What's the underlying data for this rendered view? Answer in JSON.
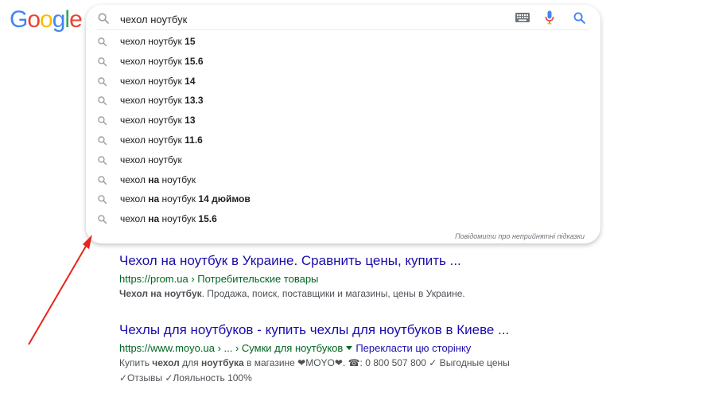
{
  "logo": {
    "letters": [
      "G",
      "o",
      "o",
      "g",
      "l",
      "e"
    ],
    "colors": [
      "#4285F4",
      "#EA4335",
      "#FBBC05",
      "#4285F4",
      "#34A853",
      "#EA4335"
    ]
  },
  "search": {
    "value": "чехол ноутбук",
    "suggestions": [
      {
        "prefix": "чехол ноутбук ",
        "bold": "15",
        "suffix": ""
      },
      {
        "prefix": "чехол ноутбук ",
        "bold": "15.6",
        "suffix": ""
      },
      {
        "prefix": "чехол ноутбук ",
        "bold": "14",
        "suffix": ""
      },
      {
        "prefix": "чехол ноутбук ",
        "bold": "13.3",
        "suffix": ""
      },
      {
        "prefix": "чехол ноутбук ",
        "bold": "13",
        "suffix": ""
      },
      {
        "prefix": "чехол ноутбук ",
        "bold": "11.6",
        "suffix": ""
      },
      {
        "prefix": "чехол ноутбук",
        "bold": "",
        "suffix": ""
      },
      {
        "prefix": "чехол ",
        "bold": "на",
        "suffix": " ноутбук"
      },
      {
        "prefix": "чехол ",
        "bold": "на",
        "suffix": " ноутбук ",
        "bold2": "14 дюймов"
      },
      {
        "prefix": "чехол ",
        "bold": "на",
        "suffix": " ноутбук ",
        "bold2": "15.6"
      }
    ],
    "report_label": "Повідомити про неприйнятні підказки"
  },
  "results": [
    {
      "title": "Чехол на ноутбук в Украине. Сравнить цены, купить ...",
      "url_host": "https://prom.ua",
      "url_path": " › Потребительские товары",
      "snippet_bold": "Чехол на ноутбук",
      "snippet_rest": ". Продажа, поиск, поставщики и магазины, цены в Украине."
    },
    {
      "title": "Чехлы для ноутбуков - купить чехлы для ноутбуков в Киеве ...",
      "url_host": "https://www.moyo.ua",
      "url_path": " › ... › Сумки для ноутбуков",
      "translate_label": "Перекласти цю сторінку",
      "snippet_line1_parts": [
        "Купить ",
        "чехол",
        " для ",
        "ноутбука",
        " в магазине ❤MOYO❤. ☎: 0 800 507 800 ✓ Выгодные цены"
      ],
      "snippet_line2": "✓Отзывы ✓Лояльность 100%"
    }
  ],
  "colors": {
    "link": "#1a0dab",
    "url": "#006621",
    "arrow": "#e8251c"
  }
}
